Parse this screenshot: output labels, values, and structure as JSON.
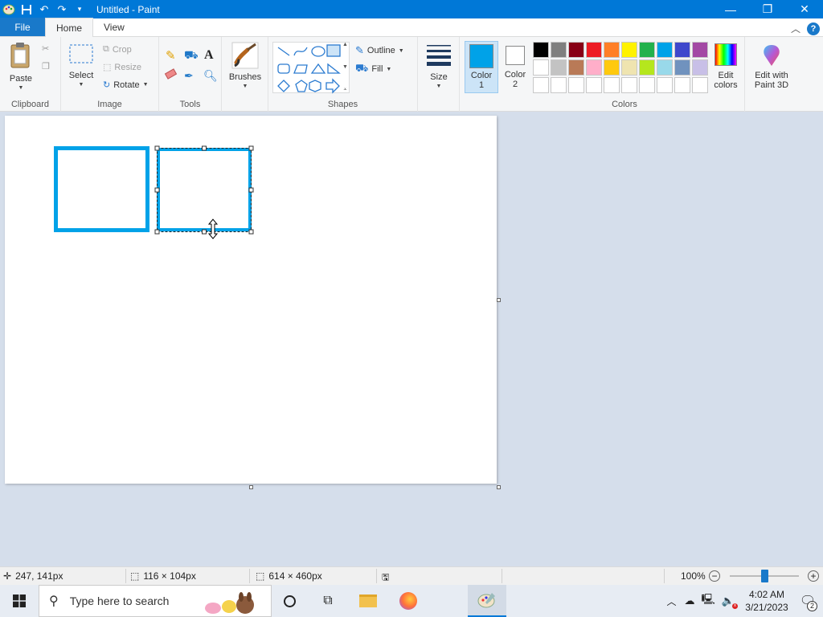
{
  "window": {
    "title": "Untitled - Paint",
    "controls": [
      "minimize",
      "maximize",
      "close"
    ]
  },
  "tabs": {
    "file": "File",
    "home": "Home",
    "view": "View"
  },
  "ribbon": {
    "clipboard": {
      "label": "Clipboard",
      "paste": "Paste"
    },
    "image": {
      "label": "Image",
      "select": "Select",
      "crop": "Crop",
      "resize": "Resize",
      "rotate": "Rotate"
    },
    "tools": {
      "label": "Tools"
    },
    "brushes": "Brushes",
    "shapes": {
      "label": "Shapes",
      "outline": "Outline",
      "fill": "Fill"
    },
    "size": "Size",
    "colors": {
      "label": "Colors",
      "color1": "Color",
      "color1_num": "1",
      "color2": "Color",
      "color2_num": "2",
      "color1_value": "#00a2e8",
      "color2_value": "#ffffff",
      "edit_colors": "Edit colors",
      "edit_paint3d": "Edit with Paint 3D",
      "palette_row1": [
        "#000000",
        "#7f7f7f",
        "#880015",
        "#ed1c24",
        "#ff7f27",
        "#fff200",
        "#22b14c",
        "#00a2e8",
        "#3f48cc",
        "#a349a4"
      ],
      "palette_row2": [
        "#ffffff",
        "#c3c3c3",
        "#b97a57",
        "#ffaec9",
        "#ffc90e",
        "#efe4b0",
        "#b5e61d",
        "#99d9ea",
        "#7092be",
        "#c8bfe7"
      ],
      "palette_row3": [
        "#ffffff",
        "#ffffff",
        "#ffffff",
        "#ffffff",
        "#ffffff",
        "#ffffff",
        "#ffffff",
        "#ffffff",
        "#ffffff",
        "#ffffff"
      ]
    }
  },
  "status": {
    "cursor_pos": "247, 141px",
    "selection_size": "116 × 104px",
    "image_size": "614 × 460px",
    "zoom": "100%",
    "zoom_fraction": 0.5
  },
  "taskbar": {
    "search_placeholder": "Type here to search",
    "time": "4:02 AM",
    "date": "3/21/2023",
    "notifications": "2"
  }
}
